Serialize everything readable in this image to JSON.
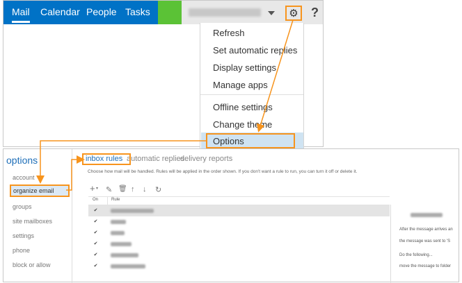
{
  "nav": {
    "items": [
      {
        "label": "Mail"
      },
      {
        "label": "Calendar"
      },
      {
        "label": "People"
      },
      {
        "label": "Tasks"
      }
    ]
  },
  "top_icons": {
    "help": "?"
  },
  "dropdown": {
    "items": [
      {
        "label": "Refresh"
      },
      {
        "label": "Set automatic replies"
      },
      {
        "label": "Display settings"
      },
      {
        "label": "Manage apps"
      },
      {
        "label": "Offline settings"
      },
      {
        "label": "Change theme"
      },
      {
        "label": "Options"
      }
    ]
  },
  "sidebar": {
    "title": "options",
    "items": [
      {
        "label": "account"
      },
      {
        "label": "organize email"
      },
      {
        "label": "groups"
      },
      {
        "label": "site mailboxes"
      },
      {
        "label": "settings"
      },
      {
        "label": "phone"
      },
      {
        "label": "block or allow"
      }
    ]
  },
  "tabs": [
    {
      "label": "inbox rules"
    },
    {
      "label": "automatic replies"
    },
    {
      "label": "delivery reports"
    }
  ],
  "description": "Choose how mail will be handled. Rules will be applied in the order shown. If you don't want a rule to run, you can turn it off or delete it.",
  "grid": {
    "col_on": "On",
    "col_rule": "Rule",
    "rows": [
      {
        "checked": "✔"
      },
      {
        "checked": "✔"
      },
      {
        "checked": "✔"
      },
      {
        "checked": "✔"
      },
      {
        "checked": "✔"
      },
      {
        "checked": "✔"
      }
    ]
  },
  "detail": {
    "line1": "After the message arrives an",
    "line2": "the message was sent to 'S",
    "line3": "Do the following...",
    "line4": "move the message to folder"
  },
  "colors": {
    "accent": "#0072c6",
    "highlight": "#f7941d",
    "green": "#5bc236"
  }
}
